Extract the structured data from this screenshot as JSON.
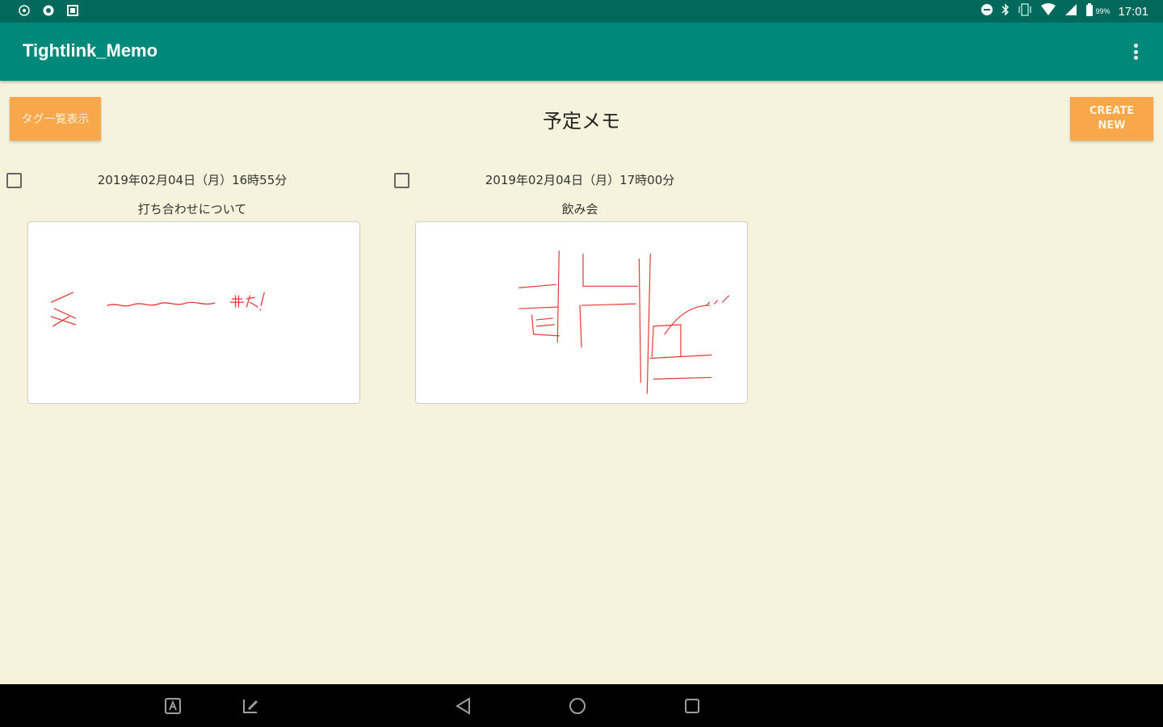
{
  "status_bar": {
    "time": "17:01",
    "battery_percent": "99%",
    "icons": [
      "notification-icon",
      "sync-icon",
      "screenshot-icon",
      "dnd-icon",
      "bluetooth-icon",
      "vibrate-icon",
      "wifi-icon",
      "cell-signal-icon",
      "battery-icon"
    ]
  },
  "app_bar": {
    "title": "Tightlink_Memo",
    "menu_icon": "overflow-menu-icon"
  },
  "toolbar": {
    "tags_button_label": "タグ一覧表示",
    "create_button_label": "CREATE\nNEW",
    "page_title": "予定メモ"
  },
  "memos": [
    {
      "datetime": "2019年02月04日（月）16時55分",
      "title": "打ち合わせについて",
      "checked": false,
      "handwriting_color": "#e53935"
    },
    {
      "datetime": "2019年02月04日（月）17時00分",
      "title": "飲み会",
      "checked": false,
      "handwriting_color": "#e53935"
    }
  ],
  "colors": {
    "status_bar": "#00695c",
    "app_bar": "#00897b",
    "background": "#f5f3dc",
    "accent_button": "#f9a74b",
    "nav_bar": "#000000"
  },
  "nav_bar": {
    "icons": [
      "app-a-icon",
      "pen-edit-icon",
      "back-icon",
      "home-icon",
      "recents-icon"
    ]
  }
}
